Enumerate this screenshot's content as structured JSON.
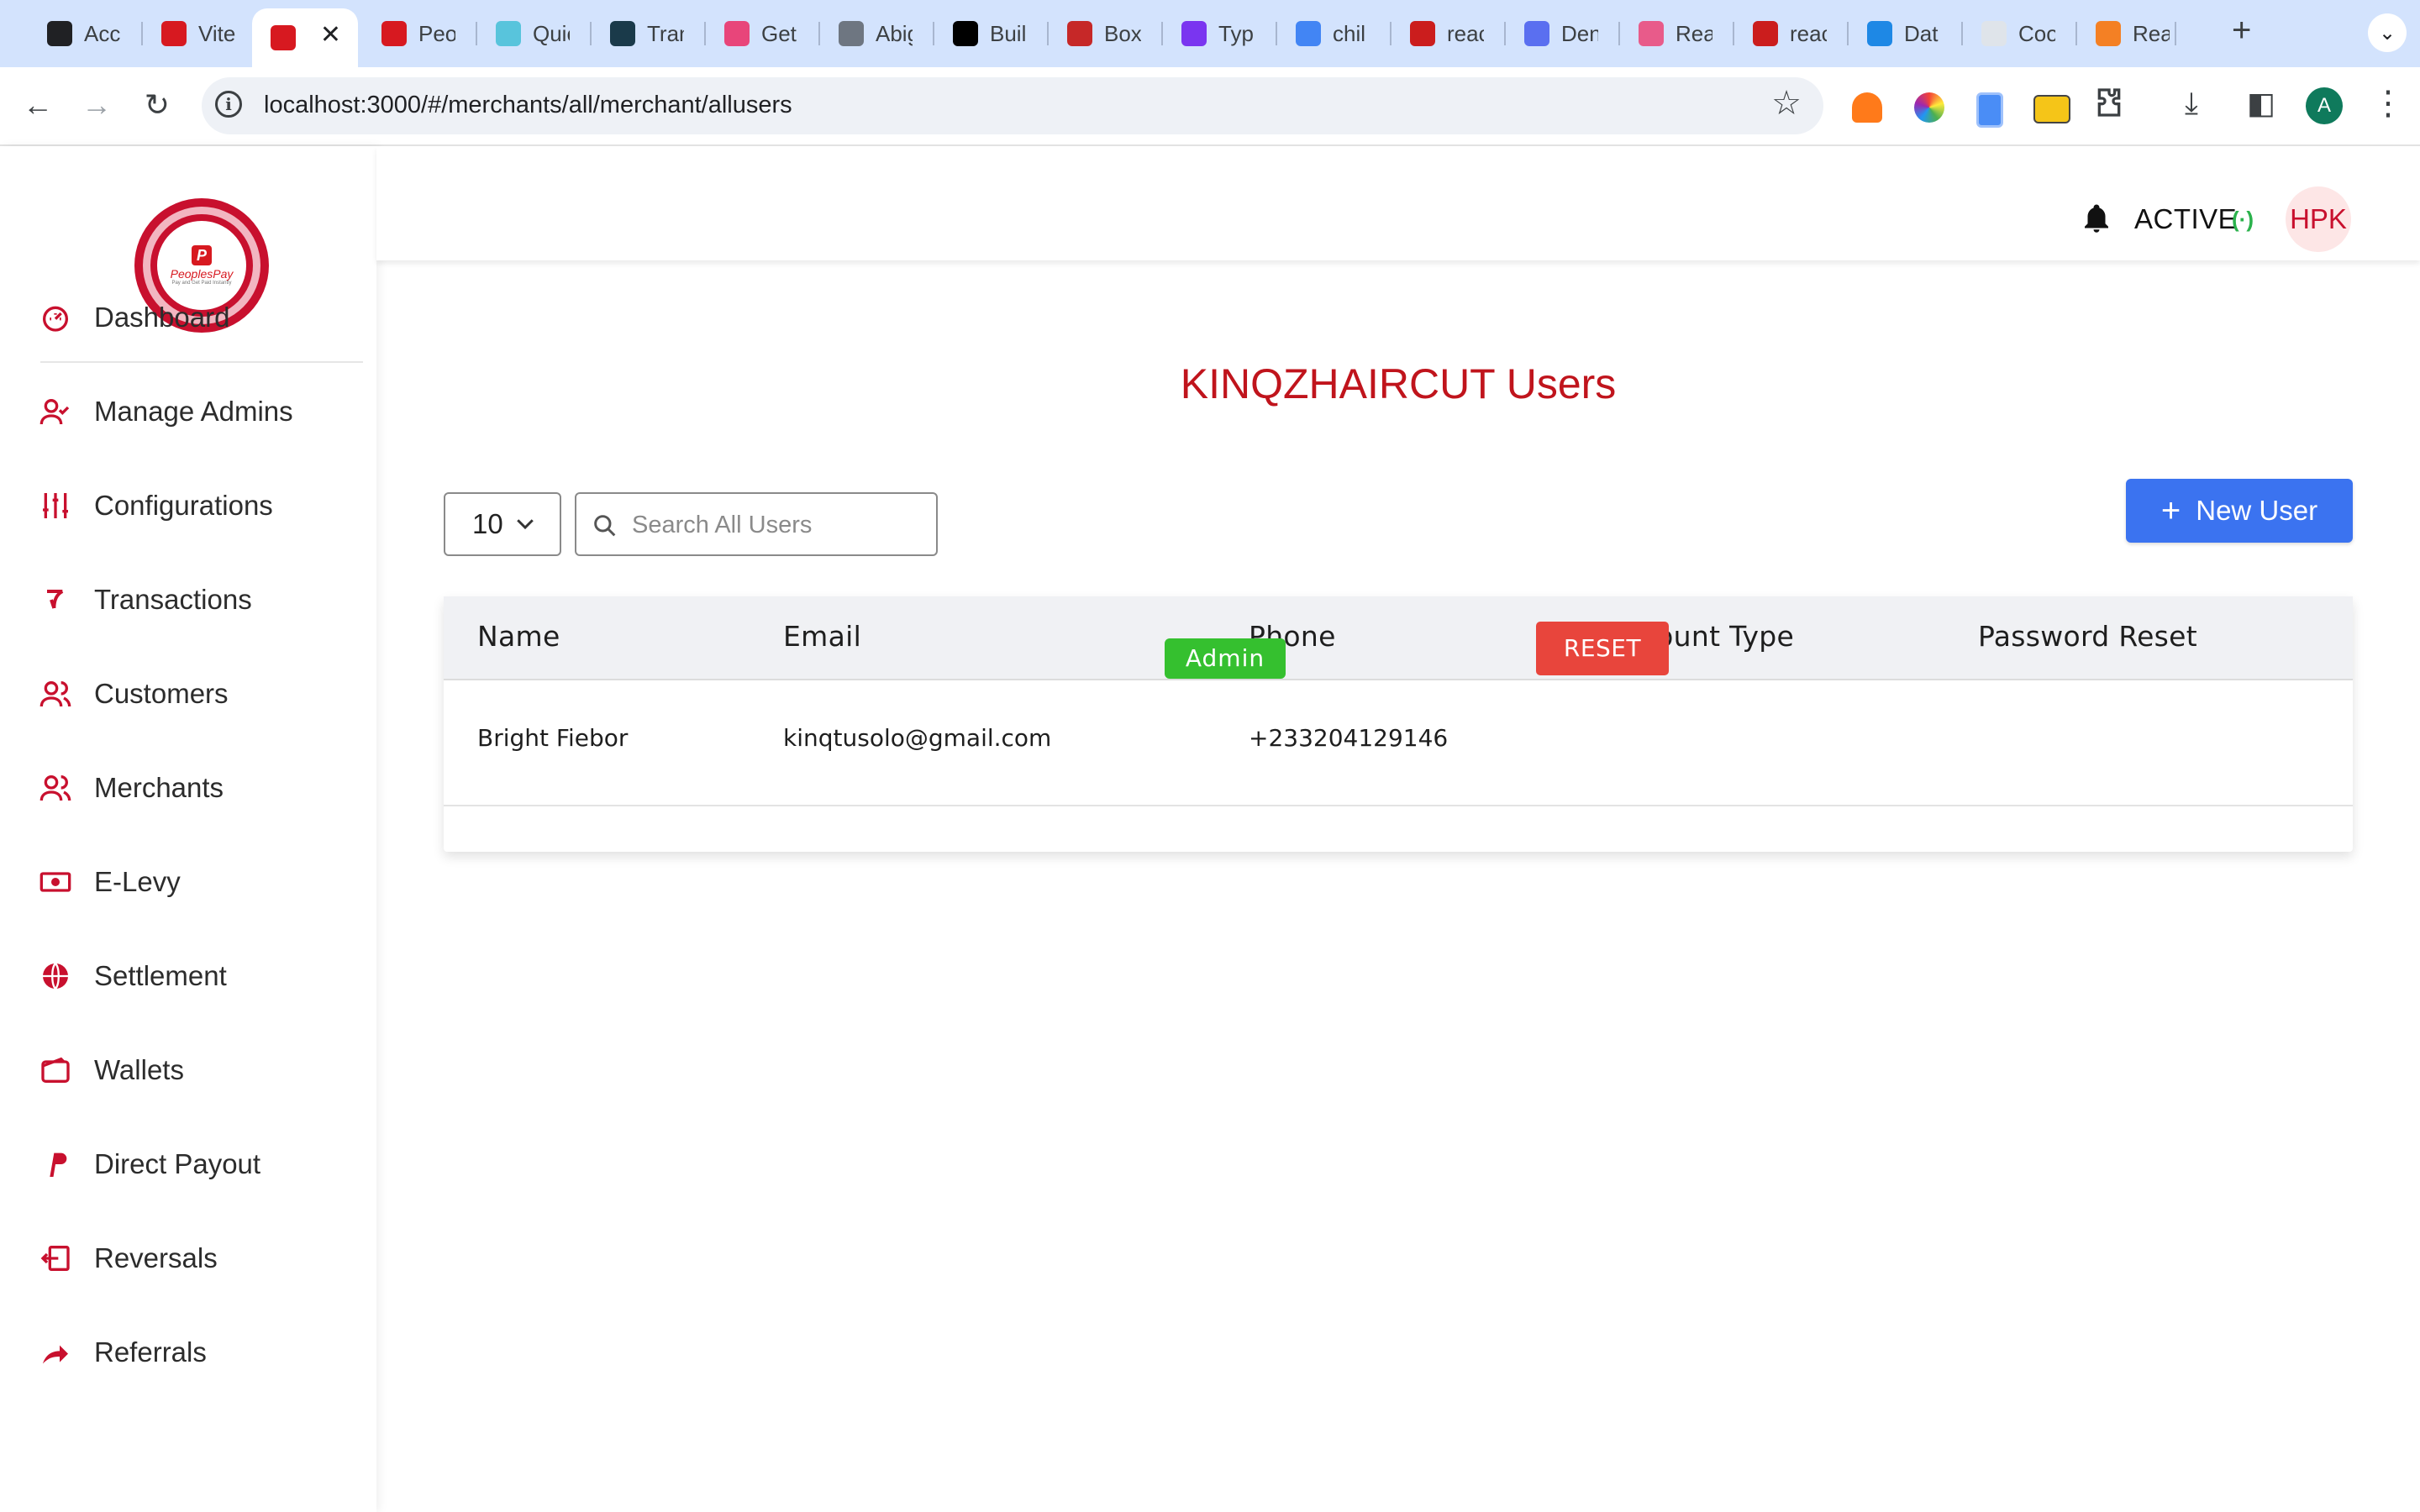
{
  "browser": {
    "tabs": [
      {
        "title": "Acc",
        "icon": "openai-icon",
        "color": "#202124"
      },
      {
        "title": "Vite",
        "icon": "peoplespay-icon",
        "color": "#d71920"
      },
      {
        "title": "",
        "icon": "peoplespay-icon",
        "color": "#d71920",
        "active": true
      },
      {
        "title": "Peo",
        "icon": "peoplespay-icon",
        "color": "#d71920"
      },
      {
        "title": "Quic",
        "icon": "react-icon",
        "color": "#58c4dc"
      },
      {
        "title": "Tran",
        "icon": "translate-icon",
        "color": "#1a3a4a"
      },
      {
        "title": "Get",
        "icon": "gradient-icon",
        "color": "#e8457a"
      },
      {
        "title": "Abig",
        "icon": "github-icon",
        "color": "#6e7681"
      },
      {
        "title": "Buil",
        "icon": "nextjs-icon",
        "color": "#000000"
      },
      {
        "title": "Box",
        "icon": "box-icon",
        "color": "#c62828"
      },
      {
        "title": "Typ",
        "icon": "bootstrap-icon",
        "color": "#7a35f0"
      },
      {
        "title": "chil",
        "icon": "google-icon",
        "color": "#4285f4"
      },
      {
        "title": "reac",
        "icon": "npm-icon",
        "color": "#cb1d1d"
      },
      {
        "title": "Den",
        "icon": "stackblitz-icon",
        "color": "#5a6ff0"
      },
      {
        "title": "Rea",
        "icon": "react-icon",
        "color": "#e85b8a"
      },
      {
        "title": "reac",
        "icon": "npm-icon",
        "color": "#cb1d1d"
      },
      {
        "title": "Dat",
        "icon": "mui-icon",
        "color": "#1e88e5"
      },
      {
        "title": "Coo",
        "icon": "blank-page-icon",
        "color": "#dfe4ea"
      },
      {
        "title": "Rea",
        "icon": "stack-icon",
        "color": "#f48024"
      }
    ],
    "close_glyph": "✕",
    "new_tab_glyph": "+",
    "tab_menu_glyph": "⌄",
    "back_glyph": "←",
    "forward_glyph": "→",
    "reload_glyph": "↻",
    "url": "localhost:3000/#/merchants/all/merchant/allusers",
    "info_glyph": "i",
    "star_glyph": "☆",
    "download_glyph": "⤓",
    "sidepanel_glyph": "◧",
    "profile_initial": "A",
    "menu_glyph": "⋮"
  },
  "sidebar": {
    "logo": {
      "letter": "P",
      "name": "PeoplesPay",
      "tagline": "Pay and Get Paid Instantly"
    },
    "items": [
      {
        "label": "Dashboard",
        "icon": "gauge-icon"
      },
      {
        "label": "Manage Admins",
        "icon": "user-check-icon"
      },
      {
        "label": "Configurations",
        "icon": "sliders-icon"
      },
      {
        "label": "Transactions",
        "icon": "transactions-icon"
      },
      {
        "label": "Customers",
        "icon": "users-icon"
      },
      {
        "label": "Merchants",
        "icon": "users-icon"
      },
      {
        "label": "E-Levy",
        "icon": "money-icon"
      },
      {
        "label": "Settlement",
        "icon": "globe-icon"
      },
      {
        "label": "Wallets",
        "icon": "wallet-icon"
      },
      {
        "label": "Direct Payout",
        "icon": "paypal-icon"
      },
      {
        "label": "Reversals",
        "icon": "reverse-icon"
      },
      {
        "label": "Referrals",
        "icon": "share-icon"
      }
    ],
    "accent": "#c8102e"
  },
  "header": {
    "status": "ACTIVE",
    "status_signal": "(·)",
    "status_color": "#2bb24c",
    "avatar_initials": "HPK"
  },
  "main": {
    "title": "KINQZHAIRCUT Users",
    "page_size": "10",
    "search_placeholder": "Search All Users",
    "new_user_plus": "+",
    "new_user_label": "New User",
    "table": {
      "columns": [
        "Name",
        "Email",
        "Phone",
        "Account Type",
        "Password Reset"
      ],
      "rows": [
        {
          "name": "Bright Fiebor",
          "email": "kinqtusolo@gmail.com",
          "phone": "+233204129146",
          "account_type": "Admin",
          "reset_label": "RESET"
        }
      ]
    }
  }
}
